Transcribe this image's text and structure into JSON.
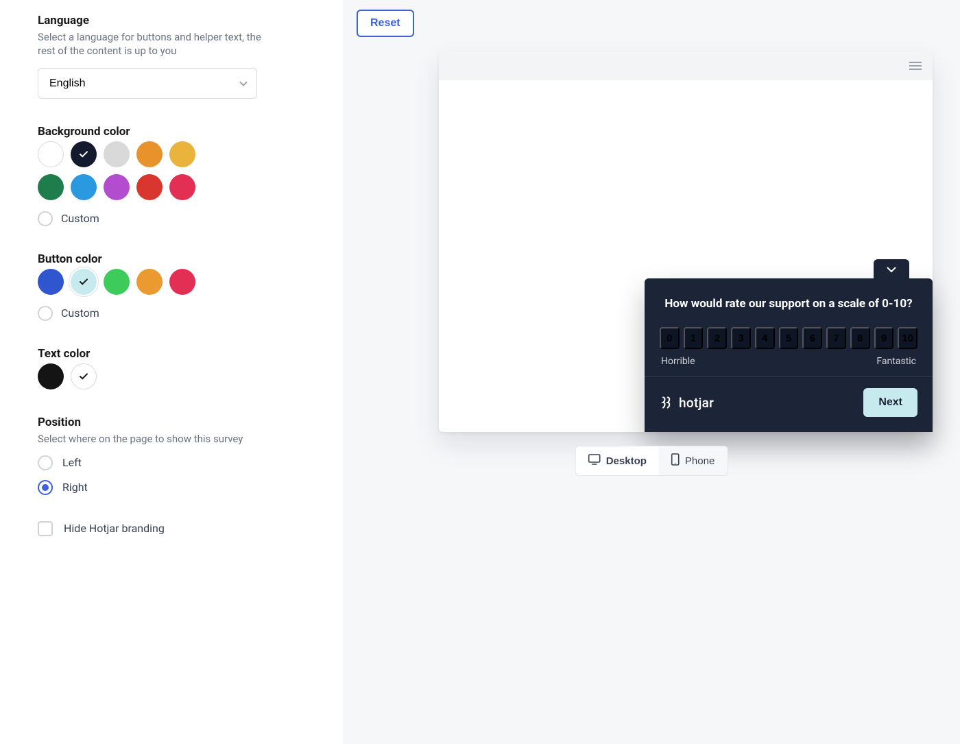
{
  "language": {
    "title": "Language",
    "sub": "Select a language for buttons and helper text, the rest of the content is up to you",
    "selected": "English"
  },
  "background": {
    "title": "Background color",
    "custom_label": "Custom",
    "swatches": [
      {
        "color": "#ffffff",
        "bordered": true,
        "selected": false
      },
      {
        "color": "#131a2d",
        "bordered": false,
        "selected": true
      },
      {
        "color": "#d9d9d9",
        "bordered": false,
        "selected": false
      },
      {
        "color": "#e8922b",
        "bordered": false,
        "selected": false
      },
      {
        "color": "#eab33c",
        "bordered": false,
        "selected": false
      },
      {
        "color": "#1f7d4c",
        "bordered": false,
        "selected": false
      },
      {
        "color": "#2a99e0",
        "bordered": false,
        "selected": false
      },
      {
        "color": "#b24dd0",
        "bordered": false,
        "selected": false
      },
      {
        "color": "#d8362f",
        "bordered": false,
        "selected": false
      },
      {
        "color": "#e42f55",
        "bordered": false,
        "selected": false
      }
    ],
    "custom_selected": false
  },
  "button": {
    "title": "Button color",
    "custom_label": "Custom",
    "swatches": [
      {
        "color": "#2f55cf",
        "bordered": false,
        "selected": false
      },
      {
        "color": "#c7eaef",
        "bordered": false,
        "selected": true,
        "check_dark": true,
        "ring": true
      },
      {
        "color": "#3dcc5b",
        "bordered": false,
        "selected": false
      },
      {
        "color": "#eb9a31",
        "bordered": false,
        "selected": false
      },
      {
        "color": "#e42f55",
        "bordered": false,
        "selected": false
      }
    ],
    "custom_selected": false
  },
  "text": {
    "title": "Text color",
    "swatches": [
      {
        "color": "#141414",
        "bordered": false,
        "selected": false
      },
      {
        "color": "#ffffff",
        "bordered": true,
        "selected": true,
        "check_dark": true
      }
    ]
  },
  "position": {
    "title": "Position",
    "sub": "Select where on the page to show this survey",
    "options": [
      {
        "label": "Left",
        "value": "left",
        "selected": false
      },
      {
        "label": "Right",
        "value": "right",
        "selected": true
      }
    ]
  },
  "branding": {
    "checkbox_label": "Hide Hotjar branding",
    "checked": false
  },
  "preview": {
    "reset_label": "Reset",
    "survey_question": "How would rate our support on a scale of 0-10?",
    "nps_values": [
      "0",
      "1",
      "2",
      "3",
      "4",
      "5",
      "6",
      "7",
      "8",
      "9",
      "10"
    ],
    "low_label": "Horrible",
    "high_label": "Fantastic",
    "next_label": "Next",
    "brand_text": "hotjar",
    "device_desktop": "Desktop",
    "device_phone": "Phone",
    "device_active": "desktop"
  }
}
